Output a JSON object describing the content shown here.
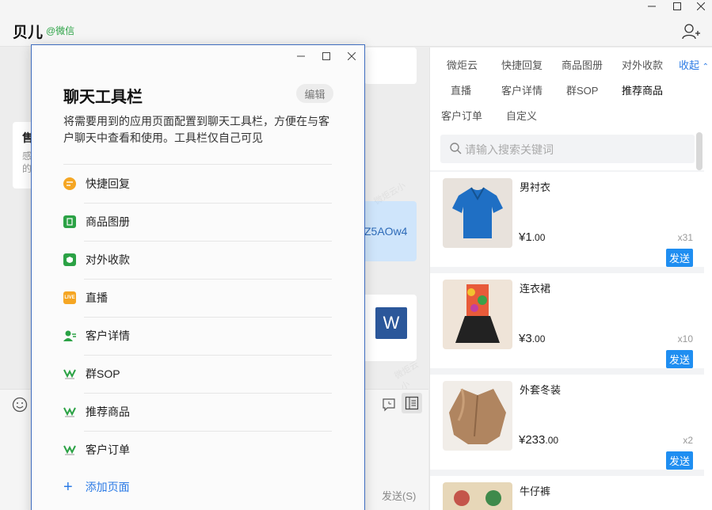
{
  "header": {
    "chat_name": "贝儿",
    "chat_source": "@微信"
  },
  "chat": {
    "bubble1_title": "售",
    "bubble1_text1": "感",
    "bubble1_text2": "的",
    "link_fragment": "Z5AOw4",
    "word_letter": "W",
    "send_label": "发送(S)"
  },
  "sidebar": {
    "tabs_row1": [
      "微炬云",
      "快捷回复",
      "商品图册",
      "对外收款"
    ],
    "collapse_label": "收起",
    "tabs_row2": [
      "直播",
      "客户详情",
      "群SOP",
      "推荐商品"
    ],
    "tabs_row3": [
      "客户订单",
      "自定义"
    ],
    "active_tab": "推荐商品",
    "search_placeholder": "请输入搜索关键词",
    "products": [
      {
        "name": "男衬衣",
        "price_int": "¥1",
        "price_dec": ".00",
        "stock": "x31",
        "send": "发送"
      },
      {
        "name": "连衣裙",
        "price_int": "¥3",
        "price_dec": ".00",
        "stock": "x10",
        "send": "发送"
      },
      {
        "name": "外套冬装",
        "price_int": "¥233",
        "price_dec": ".00",
        "stock": "x2",
        "send": "发送"
      },
      {
        "name": "牛仔裤",
        "price_int": "",
        "price_dec": "",
        "stock": "",
        "send": ""
      }
    ]
  },
  "modal": {
    "title": "聊天工具栏",
    "edit_label": "编辑",
    "description": "将需要用到的应用页面配置到聊天工具栏，方便在与客户聊天中查看和使用。工具栏仅自己可见",
    "items": [
      {
        "label": "快捷回复",
        "icon": "quick-reply-icon",
        "color": "#f5a623"
      },
      {
        "label": "商品图册",
        "icon": "product-album-icon",
        "color": "#2ba245"
      },
      {
        "label": "对外收款",
        "icon": "payment-icon",
        "color": "#2ba245"
      },
      {
        "label": "直播",
        "icon": "live-icon",
        "color": "#f5a623"
      },
      {
        "label": "客户详情",
        "icon": "customer-detail-icon",
        "color": "#2ba245"
      },
      {
        "label": "群SOP",
        "icon": "weijuyun-icon",
        "color": "#2ba245"
      },
      {
        "label": "推荐商品",
        "icon": "weijuyun-icon",
        "color": "#2ba245"
      },
      {
        "label": "客户订单",
        "icon": "weijuyun-icon",
        "color": "#2ba245"
      }
    ],
    "add_label": "添加页面"
  },
  "colors": {
    "accent_blue": "#1f8ef1",
    "link_blue": "#2c7be5",
    "wechat_green": "#2ba245",
    "modal_border": "#3f6dbf"
  }
}
